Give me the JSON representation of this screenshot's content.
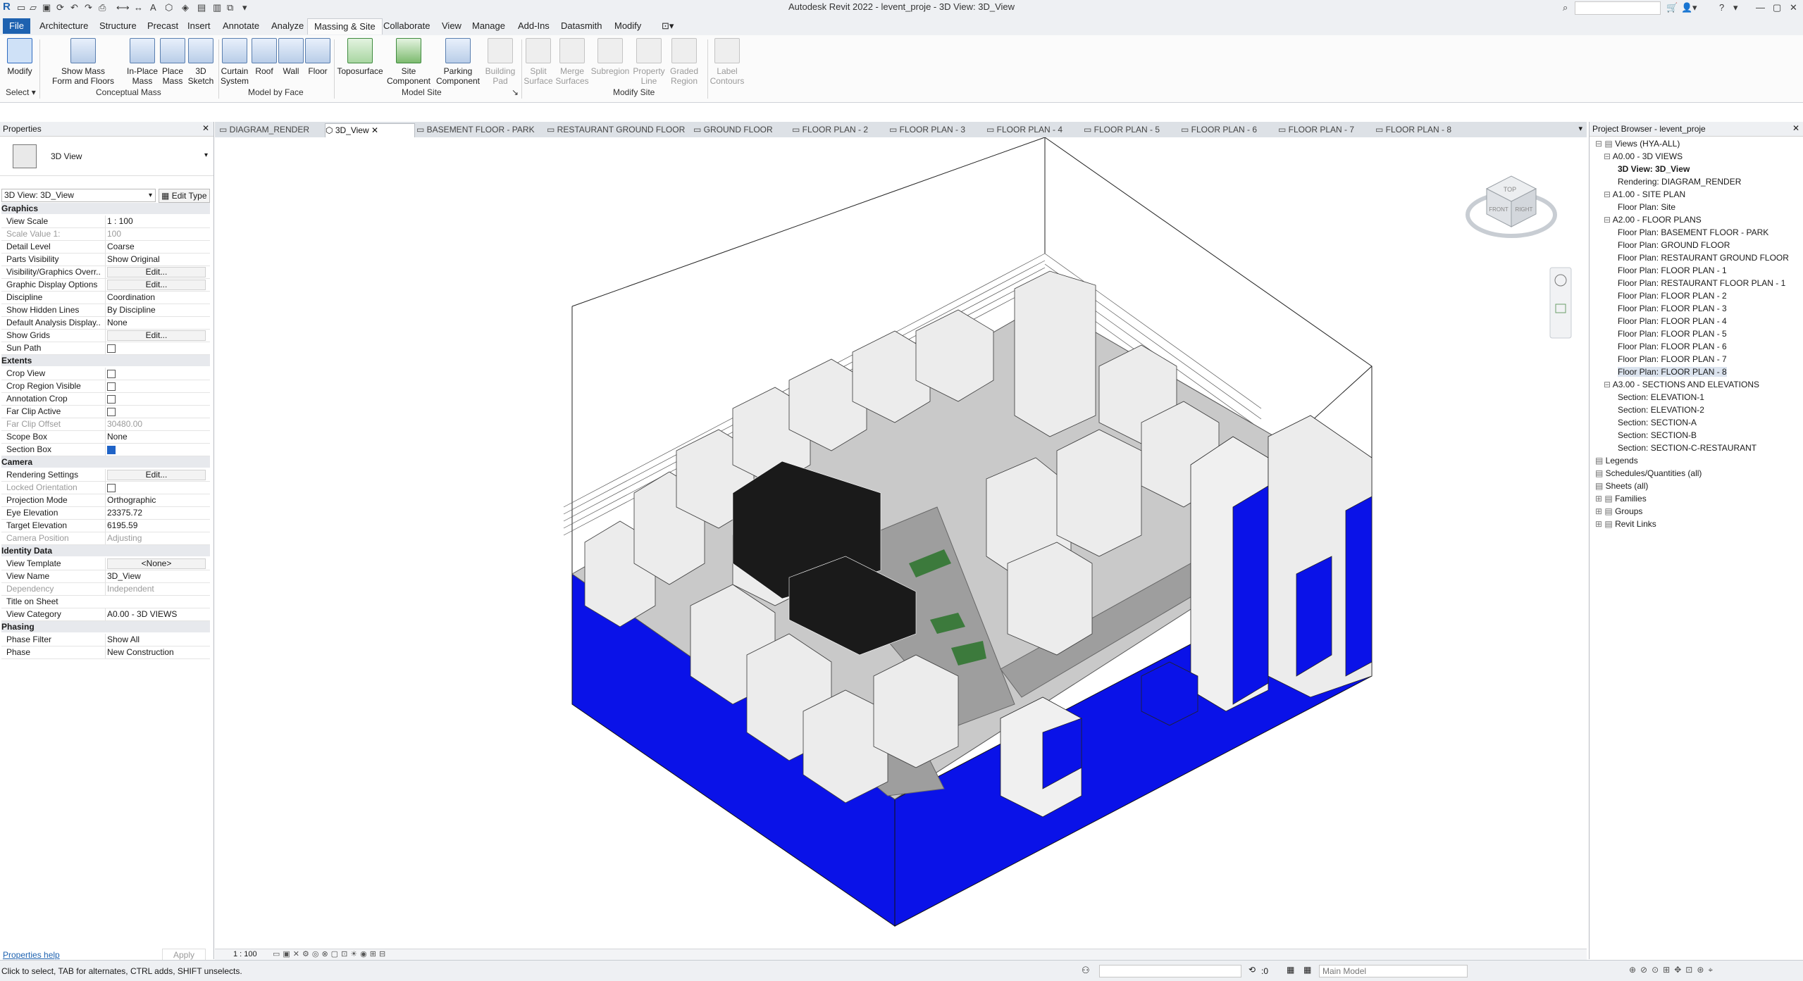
{
  "app": {
    "title": "Autodesk Revit 2022 - levent_proje - 3D View: 3D_View"
  },
  "menu_tabs": [
    "File",
    "Architecture",
    "Structure",
    "Precast",
    "Insert",
    "Annotate",
    "Analyze",
    "Massing & Site",
    "Collaborate",
    "View",
    "Manage",
    "Add-Ins",
    "Datasmith",
    "Modify"
  ],
  "ribbon": {
    "modify": "Modify",
    "select": "Select",
    "show_mass": [
      "Show Mass",
      "Form and Floors"
    ],
    "inplace_mass": [
      "In-Place",
      "Mass"
    ],
    "place_mass": [
      "Place",
      "Mass"
    ],
    "sketch_3d": [
      "3D",
      "Sketch"
    ],
    "curtain_system": [
      "Curtain",
      "System"
    ],
    "roof": "Roof",
    "wall": "Wall",
    "floor": "Floor",
    "toposurface": "Toposurface",
    "site_component": [
      "Site",
      "Component"
    ],
    "parking_component": [
      "Parking",
      "Component"
    ],
    "building_pad": [
      "Building",
      "Pad"
    ],
    "split_surface": [
      "Split",
      "Surface"
    ],
    "merge_surfaces": [
      "Merge",
      "Surfaces"
    ],
    "subregion": "Subregion",
    "property_line": [
      "Property",
      "Line"
    ],
    "graded_region": [
      "Graded",
      "Region"
    ],
    "label_contours": [
      "Label",
      "Contours"
    ],
    "panels": {
      "conceptual_mass": "Conceptual Mass",
      "model_by_face": "Model by Face",
      "model_site": "Model Site",
      "modify_site": "Modify Site"
    }
  },
  "properties": {
    "header": "Properties",
    "type_name": "3D View",
    "selector": "3D View: 3D_View",
    "edit_type": "Edit Type",
    "sections": [
      {
        "name": "Graphics",
        "rows": [
          {
            "k": "View Scale",
            "v": "1 : 100"
          },
          {
            "k": "Scale Value    1:",
            "v": "100",
            "ro": true
          },
          {
            "k": "Detail Level",
            "v": "Coarse"
          },
          {
            "k": "Parts Visibility",
            "v": "Show Original"
          },
          {
            "k": "Visibility/Graphics Overr...",
            "v": "Edit...",
            "btn": true
          },
          {
            "k": "Graphic Display Options",
            "v": "Edit...",
            "btn": true
          },
          {
            "k": "Discipline",
            "v": "Coordination"
          },
          {
            "k": "Show Hidden Lines",
            "v": "By Discipline"
          },
          {
            "k": "Default Analysis Display...",
            "v": "None"
          },
          {
            "k": "Show Grids",
            "v": "Edit...",
            "btn": true
          },
          {
            "k": "Sun Path",
            "cb": false
          }
        ]
      },
      {
        "name": "Extents",
        "rows": [
          {
            "k": "Crop View",
            "cb": false
          },
          {
            "k": "Crop Region Visible",
            "cb": false
          },
          {
            "k": "Annotation Crop",
            "cb": false
          },
          {
            "k": "Far Clip Active",
            "cb": false
          },
          {
            "k": "Far Clip Offset",
            "v": "30480.00",
            "ro": true
          },
          {
            "k": "Scope Box",
            "v": "None"
          },
          {
            "k": "Section Box",
            "cb": true
          }
        ]
      },
      {
        "name": "Camera",
        "rows": [
          {
            "k": "Rendering Settings",
            "v": "Edit...",
            "btn": true
          },
          {
            "k": "Locked Orientation",
            "cb": false,
            "ro": true
          },
          {
            "k": "Projection Mode",
            "v": "Orthographic"
          },
          {
            "k": "Eye Elevation",
            "v": "23375.72"
          },
          {
            "k": "Target Elevation",
            "v": "6195.59"
          },
          {
            "k": "Camera Position",
            "v": "Adjusting",
            "ro": true
          }
        ]
      },
      {
        "name": "Identity Data",
        "rows": [
          {
            "k": "View Template",
            "v": "<None>",
            "btn": true
          },
          {
            "k": "View Name",
            "v": "3D_View"
          },
          {
            "k": "Dependency",
            "v": "Independent",
            "ro": true
          },
          {
            "k": "Title on Sheet",
            "v": ""
          },
          {
            "k": "View Category",
            "v": "A0.00 - 3D VIEWS"
          }
        ]
      },
      {
        "name": "Phasing",
        "rows": [
          {
            "k": "Phase Filter",
            "v": "Show All"
          },
          {
            "k": "Phase",
            "v": "New Construction"
          }
        ]
      }
    ],
    "help": "Properties help",
    "apply": "Apply"
  },
  "view_tabs": [
    {
      "label": "DIAGRAM_RENDER",
      "active": false
    },
    {
      "label": "3D_View",
      "active": true
    },
    {
      "label": "BASEMENT FLOOR - PARK",
      "active": false
    },
    {
      "label": "RESTAURANT GROUND FLOOR",
      "active": false
    },
    {
      "label": "GROUND FLOOR",
      "active": false
    },
    {
      "label": "FLOOR PLAN - 2",
      "active": false
    },
    {
      "label": "FLOOR PLAN - 3",
      "active": false
    },
    {
      "label": "FLOOR PLAN - 4",
      "active": false
    },
    {
      "label": "FLOOR PLAN - 5",
      "active": false
    },
    {
      "label": "FLOOR PLAN - 6",
      "active": false
    },
    {
      "label": "FLOOR PLAN - 7",
      "active": false
    },
    {
      "label": "FLOOR PLAN - 8",
      "active": false
    }
  ],
  "view_control": {
    "scale": "1 : 100"
  },
  "viewcube": {
    "top": "TOP",
    "right": "RIGHT",
    "front": "FRONT"
  },
  "browser": {
    "header": "Project Browser - levent_proje",
    "items": [
      {
        "t": "Views (HYA-ALL)",
        "lvl": 0,
        "exp": true
      },
      {
        "t": "A0.00 - 3D VIEWS",
        "lvl": 1,
        "exp": true
      },
      {
        "t": "3D View: 3D_View",
        "lvl": 2,
        "bold": true
      },
      {
        "t": "Rendering: DIAGRAM_RENDER",
        "lvl": 2
      },
      {
        "t": "A1.00 - SITE PLAN",
        "lvl": 1,
        "exp": true
      },
      {
        "t": "Floor Plan: Site",
        "lvl": 2
      },
      {
        "t": "A2.00 - FLOOR PLANS",
        "lvl": 1,
        "exp": true
      },
      {
        "t": "Floor Plan: BASEMENT FLOOR - PARK",
        "lvl": 2
      },
      {
        "t": "Floor Plan: GROUND FLOOR",
        "lvl": 2
      },
      {
        "t": "Floor Plan: RESTAURANT GROUND FLOOR",
        "lvl": 2
      },
      {
        "t": "Floor Plan: FLOOR PLAN - 1",
        "lvl": 2
      },
      {
        "t": "Floor Plan: RESTAURANT FLOOR PLAN - 1",
        "lvl": 2
      },
      {
        "t": "Floor Plan: FLOOR PLAN - 2",
        "lvl": 2
      },
      {
        "t": "Floor Plan: FLOOR PLAN - 3",
        "lvl": 2
      },
      {
        "t": "Floor Plan: FLOOR PLAN - 4",
        "lvl": 2
      },
      {
        "t": "Floor Plan: FLOOR PLAN - 5",
        "lvl": 2
      },
      {
        "t": "Floor Plan: FLOOR PLAN - 6",
        "lvl": 2
      },
      {
        "t": "Floor Plan: FLOOR PLAN - 7",
        "lvl": 2
      },
      {
        "t": "Floor Plan: FLOOR PLAN - 8",
        "lvl": 2,
        "hl": true
      },
      {
        "t": "A3.00 - SECTIONS AND ELEVATIONS",
        "lvl": 1,
        "exp": true
      },
      {
        "t": "Section: ELEVATION-1",
        "lvl": 2
      },
      {
        "t": "Section: ELEVATION-2",
        "lvl": 2
      },
      {
        "t": "Section: SECTION-A",
        "lvl": 2
      },
      {
        "t": "Section: SECTION-B",
        "lvl": 2
      },
      {
        "t": "Section: SECTION-C-RESTAURANT",
        "lvl": 2
      },
      {
        "t": "Legends",
        "lvl": 0
      },
      {
        "t": "Schedules/Quantities (all)",
        "lvl": 0
      },
      {
        "t": "Sheets (all)",
        "lvl": 0
      },
      {
        "t": "Families",
        "lvl": 0,
        "exp": false
      },
      {
        "t": "Groups",
        "lvl": 0,
        "exp": false
      },
      {
        "t": "Revit Links",
        "lvl": 0,
        "exp": false
      }
    ]
  },
  "status": {
    "message": "Click to select, TAB for alternates, CTRL adds, SHIFT unselects.",
    "worksets": ":0",
    "model": "Main Model"
  },
  "colors": {
    "accent": "#1e62b0",
    "section_box": "#0a12e8"
  }
}
